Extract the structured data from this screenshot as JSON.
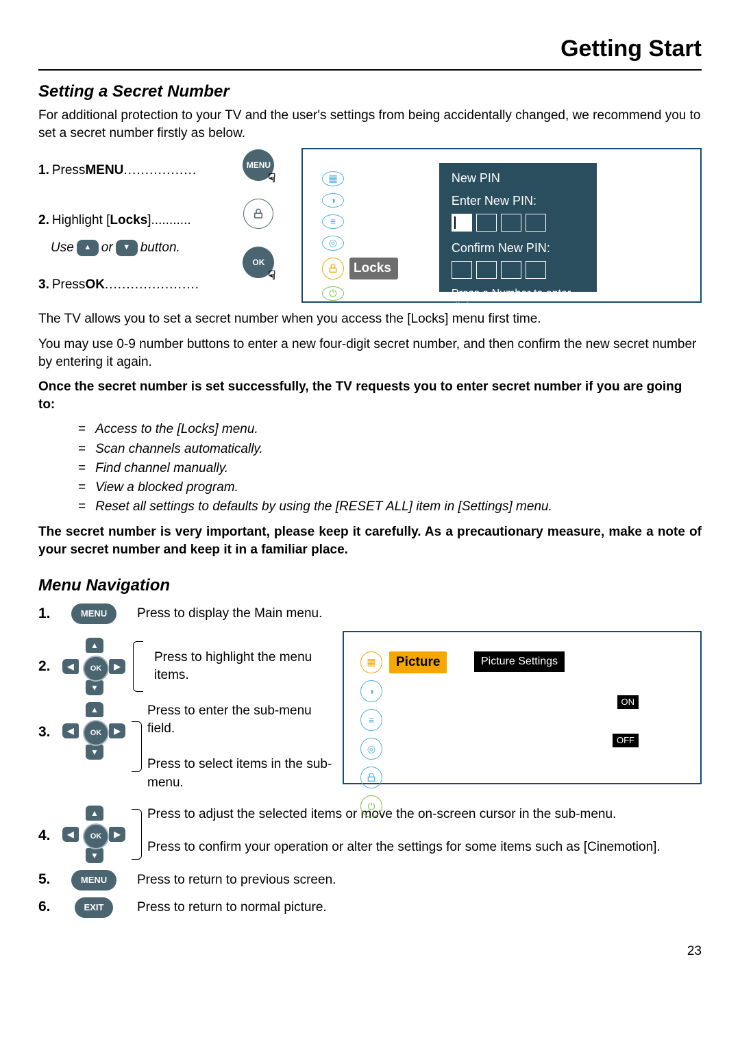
{
  "header": {
    "title": "Getting Start"
  },
  "section1": {
    "heading": "Setting a Secret Number",
    "intro": "For additional protection to your TV and the user's settings from being accidentally changed, we recommend you to set a secret number firstly as below.",
    "step1_num": "1.",
    "step1_text_a": "Press ",
    "step1_text_b": "MENU",
    "step1_dots": ".................",
    "step2_num": "2.",
    "step2_text_a": "Highlight [",
    "step2_text_b": "Locks",
    "step2_text_c": "]...........",
    "step2_use_a": "Use",
    "step2_use_b": "or",
    "step2_use_c": "button.",
    "step3_num": "3.",
    "step3_text_a": "Press ",
    "step3_text_b": "OK",
    "step3_dots": "......................",
    "menu_btn": "MENU",
    "ok_btn": "OK",
    "up_glyph": "▲",
    "down_glyph": "▼"
  },
  "osd1": {
    "locks_label": "Locks",
    "panel_title": "New PIN",
    "enter_label": "Enter New PIN:",
    "confirm_label": "Confirm New PIN:",
    "hint": "Press a Number to enter digit"
  },
  "paras": {
    "p1": "The TV allows you to set a secret number when you access the [Locks] menu first time.",
    "p2": "You may use 0-9 number buttons to enter a new four-digit secret number, and then confirm the new secret number by entering it again.",
    "p3": "Once the secret number is set successfully, the TV requests you to enter secret number if you are going to:",
    "li1": "Access to the [Locks] menu.",
    "li2": "Scan channels automatically.",
    "li3": "Find channel manually.",
    "li4": "View a blocked program.",
    "li5": "Reset all settings to defaults by using the [RESET ALL] item in [Settings] menu.",
    "p4": "The secret number is very important, please keep it carefully. As a precautionary measure, make a note of your secret number and keep it in a familiar place."
  },
  "section2": {
    "heading": "Menu Navigation",
    "n1": "1.",
    "n2": "2.",
    "n3": "3.",
    "n4": "4.",
    "n5": "5.",
    "n6": "6.",
    "menu_btn": "MENU",
    "exit_btn": "EXIT",
    "ok_btn": "OK",
    "d1": "Press to display the Main menu.",
    "d2": "Press to highlight the menu items.",
    "d3a": "Press to enter the sub-menu field.",
    "d3b": "Press to select items in the sub-menu.",
    "d4a": "Press to adjust the selected items or move the on-screen cursor in the sub-menu.",
    "d4b": "Press to confirm your operation or alter the settings for some items such as [Cinemotion].",
    "d5": "Press to return to previous screen.",
    "d6": "Press to return to normal picture."
  },
  "osd2": {
    "picture_label": "Picture",
    "settings_label": "Picture Settings",
    "on": "ON",
    "off": "OFF"
  },
  "footer": {
    "page": "23"
  }
}
